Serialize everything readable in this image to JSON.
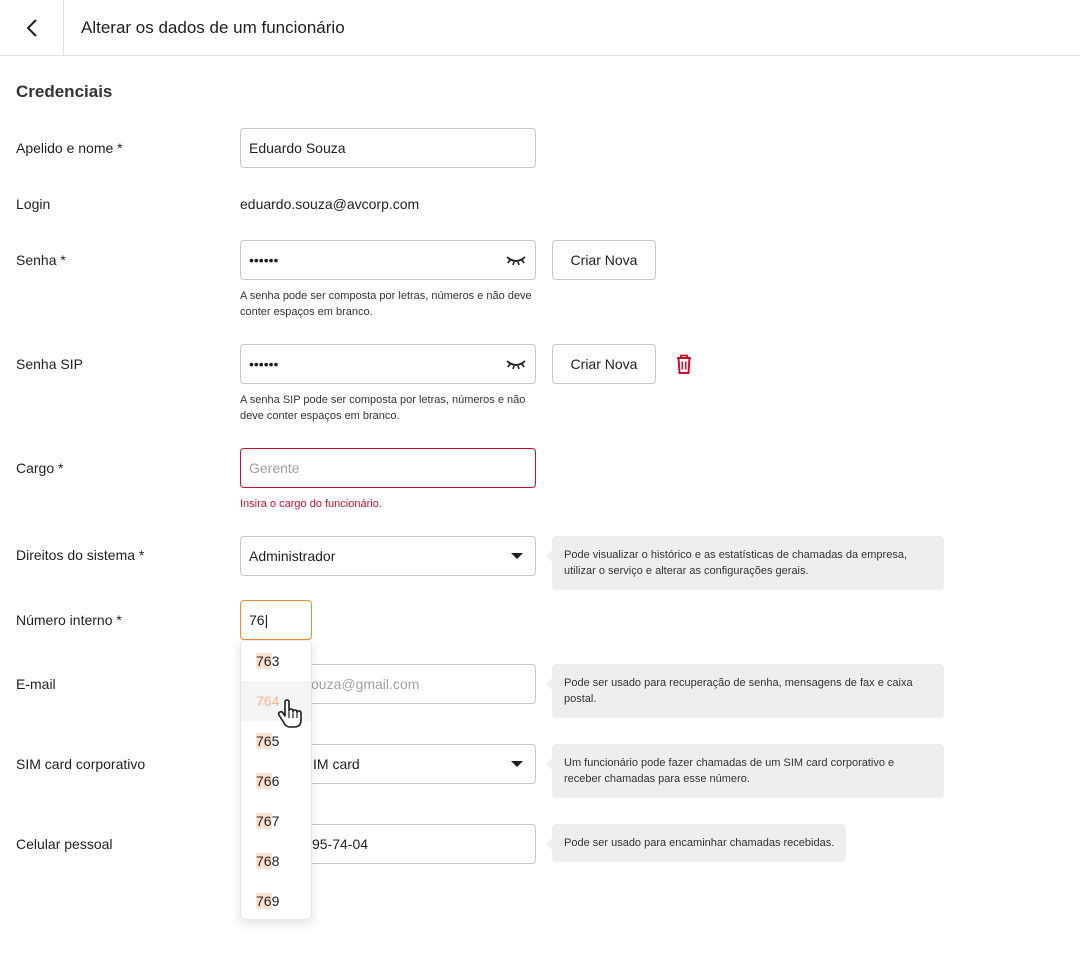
{
  "header": {
    "title": "Alterar os dados de um funcionário"
  },
  "section": {
    "title": "Credenciais"
  },
  "fields": {
    "name": {
      "label": "Apelido e nome *",
      "value": "Eduardo Souza"
    },
    "login": {
      "label": "Login",
      "value": "eduardo.souza@avcorp.com"
    },
    "password": {
      "label": "Senha *",
      "value": "••••••",
      "button": "Criar Nova",
      "hint": "A senha pode ser composta por letras, números e não deve conter espaços em branco."
    },
    "sip_password": {
      "label": "Senha SIP",
      "value": "••••••",
      "button": "Criar Nova",
      "hint": "A senha SIP pode ser composta por letras, números e não deve conter espaços em branco."
    },
    "position": {
      "label": "Cargo *",
      "placeholder": "Gerente",
      "error": "Insira o cargo do funcionário."
    },
    "rights": {
      "label": "Direitos do sistema *",
      "value": "Administrador",
      "tooltip": "Pode visualizar o histórico e as estatísticas de chamadas da empresa, utilizar o serviço e alterar as configurações gerais."
    },
    "extension": {
      "label": "Número interno *",
      "value": "76|"
    },
    "email": {
      "label": "E-mail",
      "placeholder": "ouza@gmail.com",
      "tooltip": "Pode ser usado para recuperação de senha, mensagens de fax e caixa postal."
    },
    "sim": {
      "label": "SIM card corporativo",
      "value": "IM card",
      "tooltip": "Um funcionário pode fazer chamadas de um SIM card corporativo e receber chamadas para esse número."
    },
    "mobile": {
      "label": "Celular pessoal",
      "value": "95-74-04",
      "tooltip": "Pode ser usado para encaminhar chamadas recebidas."
    }
  },
  "suggestions": {
    "match": "76",
    "items": [
      {
        "suffix": "3"
      },
      {
        "suffix": "4"
      },
      {
        "suffix": "5"
      },
      {
        "suffix": "6"
      },
      {
        "suffix": "7"
      },
      {
        "suffix": "8"
      },
      {
        "suffix": "9"
      }
    ]
  },
  "colors": {
    "error": "#c8102e",
    "focus": "#f08a2c",
    "match_highlight": "#fde0d2",
    "tooltip_bg": "#eeeeee"
  }
}
